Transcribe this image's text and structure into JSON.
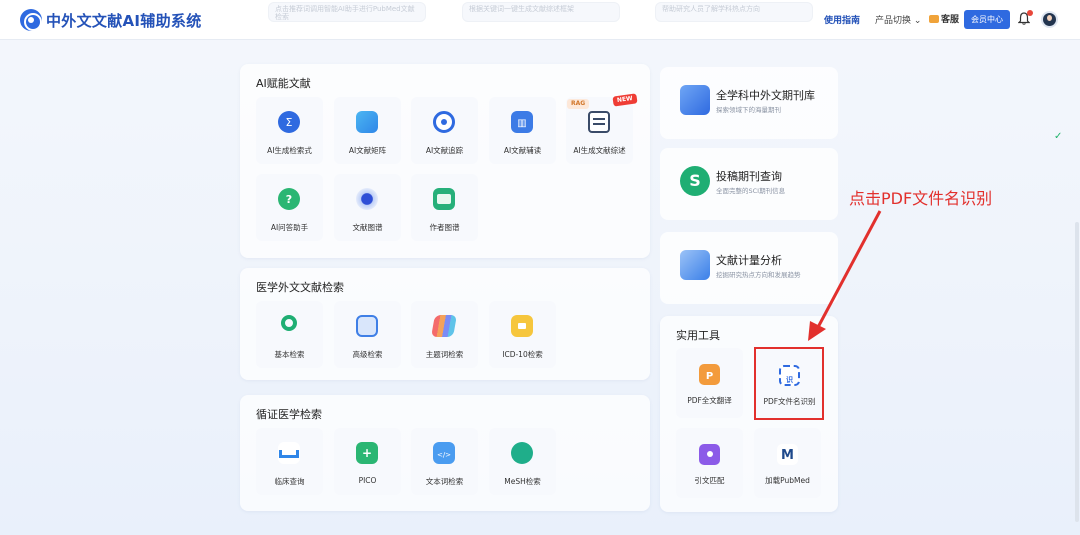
{
  "header": {
    "brand": "中外文文献AI辅助系统",
    "ghost_cards": [
      "点击推荐词调用智能AI助手进行PubMed文献检索",
      "根据关键词一键生成文献综述框架",
      "帮助研究人员了解学科热点方向"
    ],
    "nav_guide": "使用指南",
    "nav_switch": "产品切换",
    "nav_service": "客服",
    "member_button": "会员中心"
  },
  "ai_panel": {
    "title": "AI赋能文献",
    "tiles": [
      {
        "label": "AI生成检索式",
        "icon": "sigma-icon"
      },
      {
        "label": "AI文献矩阵",
        "icon": "matrix-icon"
      },
      {
        "label": "AI文献追踪",
        "icon": "target-icon"
      },
      {
        "label": "AI文献辅读",
        "icon": "reading-icon"
      },
      {
        "label": "AI生成文献综述",
        "icon": "review-icon"
      },
      {
        "label": "AI问答助手",
        "icon": "chat-question-icon"
      },
      {
        "label": "文献图谱",
        "icon": "graph-icon"
      },
      {
        "label": "作者图谱",
        "icon": "author-card-icon"
      }
    ],
    "badge_rag": "RAG",
    "badge_new": "NEW"
  },
  "medical_panel": {
    "title": "医学外文文献检索",
    "tiles": [
      {
        "label": "基本检索",
        "icon": "magnifier-icon"
      },
      {
        "label": "高级检索",
        "icon": "advanced-search-icon"
      },
      {
        "label": "主题词检索",
        "icon": "subject-cards-icon"
      },
      {
        "label": "ICD-10检索",
        "icon": "folder-icon"
      }
    ]
  },
  "evidence_panel": {
    "title": "循证医学检索",
    "tiles": [
      {
        "label": "临床查询",
        "icon": "bed-icon"
      },
      {
        "label": "PICO",
        "icon": "medical-box-icon"
      },
      {
        "label": "文本词检索",
        "icon": "code-doc-icon"
      },
      {
        "label": "MeSH检索",
        "icon": "mesh-search-icon"
      }
    ]
  },
  "feature_cards": [
    {
      "title": "全学科中外文期刊库",
      "desc": "探索领域下的海量期刊",
      "icon": "journal-library-icon"
    },
    {
      "title": "投稿期刊查询",
      "desc": "全面完整的SCI期刊信息",
      "icon": "sci-journal-icon"
    },
    {
      "title": "文献计量分析",
      "desc": "挖掘研究热点方向和发展趋势",
      "icon": "bibliometrics-chart-icon"
    }
  ],
  "tools_panel": {
    "title": "实用工具",
    "tools": [
      {
        "label": "PDF全文翻译",
        "icon": "pdf-translate-icon"
      },
      {
        "label": "PDF文件名识别",
        "icon": "scan-recognize-icon"
      },
      {
        "label": "引文匹配",
        "icon": "citation-match-icon"
      },
      {
        "label": "加载PubMed",
        "icon": "pubmed-logo-icon"
      }
    ]
  },
  "annotation": "点击PDF文件名识别",
  "colors": {
    "brand": "#2452b8",
    "accent": "#2f6ae0",
    "annotation": "#e2302d"
  }
}
